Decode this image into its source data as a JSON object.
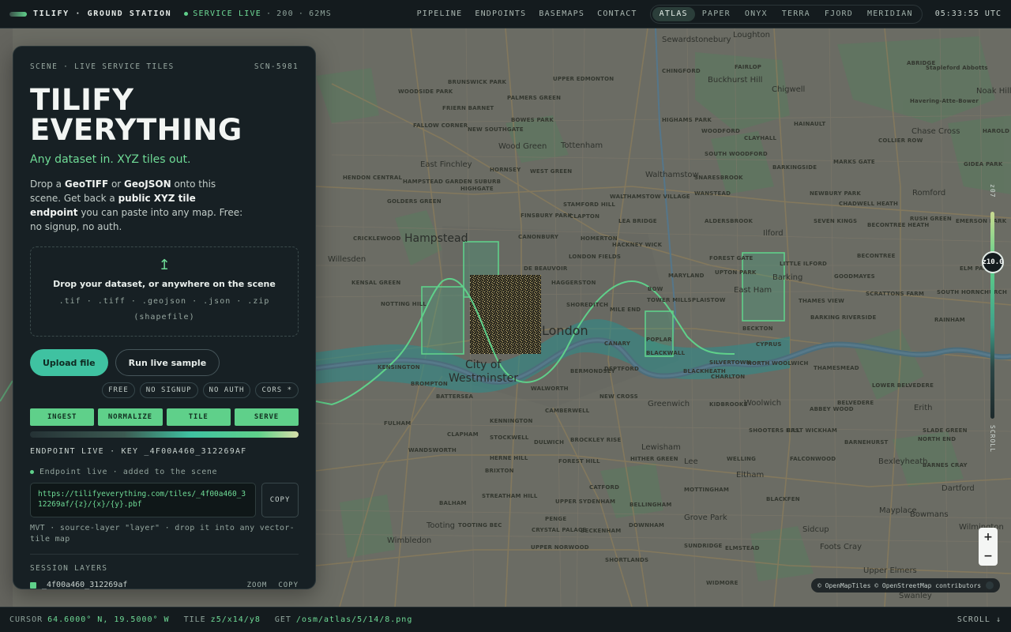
{
  "topbar": {
    "brand": "TILIFY · GROUND STATION",
    "status_label": "SERVICE LIVE",
    "status_code": "200",
    "status_latency": "62MS",
    "nav": [
      "PIPELINE",
      "ENDPOINTS",
      "BASEMAPS",
      "CONTACT"
    ],
    "styles": [
      "ATLAS",
      "PAPER",
      "ONYX",
      "TERRA",
      "FJORD",
      "MERIDIAN"
    ],
    "active_style": "ATLAS",
    "clock": "05:33:55 UTC"
  },
  "panel": {
    "eyebrow": "SCENE · LIVE SERVICE TILES",
    "scene_id": "SCN-5981",
    "headline_line1": "TILIFY",
    "headline_line2": "EVERYTHING",
    "tagline": "Any dataset in. XYZ tiles out.",
    "intro": {
      "t1": "Drop a ",
      "b1": "GeoTIFF",
      "t2": " or ",
      "b2": "GeoJSON",
      "t3": " onto this scene. Get back a ",
      "b3": "public XYZ tile endpoint",
      "t4": " you can paste into any map. Free: no signup, no auth."
    },
    "dropzone": {
      "title": "Drop your dataset, or anywhere on the scene",
      "extensions": ".tif · .tiff · .geojson · .json · .zip (shapefile)"
    },
    "upload_label": "Upload file",
    "sample_label": "Run live sample",
    "badges": [
      "FREE",
      "NO SIGNUP",
      "NO AUTH",
      "CORS *"
    ],
    "stages": [
      "INGEST",
      "NORMALIZE",
      "TILE",
      "SERVE"
    ],
    "endpoint_header": "ENDPOINT LIVE · KEY _4F00A460_312269AF",
    "endpoint_status": "Endpoint live · added to the scene",
    "endpoint_url": "https://tilifyeverything.com/tiles/_4f00a460_312269af/{z}/{x}/{y}.pbf",
    "copy_label": "COPY",
    "mvt_note": "MVT · source-layer \"layer\" · drop it into any vector-tile map",
    "session_header": "SESSION LAYERS",
    "layers": [
      {
        "name": "_4f00a460_312269af",
        "zoom_label": "ZOOM",
        "copy_label": "COPY",
        "color": "#5fd08a"
      }
    ]
  },
  "map": {
    "labels": {
      "hampstead": "Hampstead",
      "london": "London",
      "city_of": "City of",
      "westminster": "Westminster",
      "walthamstow": "Walthamstow",
      "tottenham": "Tottenham",
      "wood_green": "Wood Green",
      "east_finchley": "East Finchley",
      "willesden": "Willesden",
      "ilford": "Ilford",
      "romford": "Romford",
      "east_ham": "East Ham",
      "barking": "Barking",
      "woolwich": "Woolwich",
      "greenwich": "Greenwich",
      "lewisham": "Lewisham",
      "eltham": "Eltham",
      "bexleyheath": "Bexleyheath",
      "erith": "Erith",
      "dartford": "Dartford",
      "sidcup": "Sidcup",
      "wimbledon": "Wimbledon",
      "tooting": "Tooting",
      "lee": "Lee",
      "loughton": "Loughton",
      "chigwell": "Chigwell",
      "buckhurst_hill": "Buckhurst Hill",
      "foots_cray": "Foots Cray",
      "swanley": "Swanley",
      "upper_norwood": "UPPER NORWOOD",
      "clapham": "CLAPHAM",
      "brixton": "BRIXTON",
      "camberwell": "CAMBERWELL",
      "peckham": "PECKHAM",
      "fulham": "FULHAM",
      "kensington": "KENSINGTON",
      "islington": "ISLINGTON",
      "hackney": "HACKNEY",
      "stratford": "STRATFORD",
      "plaistow": "PLAISTOW",
      "poplar": "POPLAR",
      "mile_end": "MILE END",
      "bow": "BOW",
      "leyton": "LEYTON",
      "stoke_newington": "STOKE NEWINGTON",
      "highgate": "HIGHGATE",
      "hornsey": "HORNSEY",
      "kilburn": "KILBURN",
      "cricklewood": "CRICKLEWOOD",
      "golders_green": "GOLDERS GREEN",
      "hendon": "HENDON CENTRAL",
      "sydenham": "SYDENHAM",
      "catford": "CATFORD",
      "bromley": "BROMLEY",
      "mottingham": "MOTTINGHAM",
      "plumstead": "PLUMSTEAD",
      "thamesmead": "THAMESMEAD",
      "dagenham": "DAGENHAM",
      "hornchurch": "HORNCHURCH",
      "chadwell_heath": "CHADWELL HEATH",
      "seven_kings": "SEVEN KINGS",
      "gants_hill": "GANTS HILL",
      "woodford": "WOODFORD",
      "walthamstow_v": "WALTHAMSTOW VILLAGE",
      "chingford": "CHINGFORD",
      "hainault": "HAINAULT",
      "rainham": "RAINHAM",
      "sewardstonebury": "Sewardstonebury",
      "abridge": "ABRIDGE",
      "stapleford": "Stapleford Abbotts",
      "havering": "Havering-Atte-Bower",
      "noak_hill": "Noak Hill",
      "chase_cross": "Chase Cross",
      "harold_hill": "HAROLD HILL",
      "collier_row": "COLLIER ROW",
      "slade_green": "SLADE GREEN",
      "welling": "WELLING",
      "blackheath": "BLACKHEATH",
      "new_eltham": "NEW ELTHAM",
      "chislehurst": "CHISLEHURST",
      "orpington": "ORPINGTON",
      "petts_wood": "PETTS WOOD",
      "beckenham": "BECKENHAM",
      "penge": "PENGE",
      "crystal_palace": "CRYSTAL PALACE",
      "streatham": "STREATHAM",
      "dulwich": "DULWICH",
      "battersea": "BATTERSEA",
      "wandsworth": "WANDSWORTH",
      "putney": "PUTNEY",
      "hammersmith": "HAMMERSMITH",
      "acton": "ACTON",
      "ealing": "EALING",
      "shepherds_bush": "SHEPHERD'S BUSH",
      "walworth": "WALWORTH",
      "bermondsey": "BERMONDSEY",
      "deptford": "DEPTFORD",
      "new_cross": "NEW CROSS",
      "brockley": "BROCKLEY",
      "forest_hill": "FOREST HILL",
      "herne_hill": "HERNE HILL",
      "stockwell": "STOCKWELL",
      "vauxhall": "VAUXHALL",
      "kennington": "KENNINGTON",
      "hoxton": "HOXTON",
      "dalston": "DALSTON",
      "homerton": "HOMERTON",
      "hackney_wick": "HACKNEY WICK",
      "shoreditch": "SHOREDITCH",
      "haggerston": "HAGGERSTON",
      "bethnal_green": "BETHNAL GREEN",
      "whitechapel": "WHITECHAPEL",
      "canary": "CANARY",
      "wapping": "WAPPING",
      "silvertown": "SILVERTOWN",
      "canning_town": "CANNING TOWN",
      "north_woolwich": "NORTH WOOLWICH",
      "charlton": "CHARLTON",
      "kidbrooke": "KIDBROOKE",
      "lower_belvedere": "LOWER BELVEDERE",
      "abbey_wood": "ABBEY WOOD",
      "blackfen": "BLACKFEN",
      "upper_sydenham": "UPPER SYDENHAM",
      "streatham_hill": "STREATHAM HILL",
      "grove_park": "Grove Park",
      "upper_elmers": "Upper Elmers",
      "sundridge": "SUNDRIDGE",
      "shortlands": "SHORTLANDS",
      "widmore": "WIDMORE",
      "elmstead": "ELMSTEAD",
      "mitcham": "MITCHAM",
      "wimbledon_park": "WIMBLEDON PARK",
      "tooting_bec": "TOOTING BEC",
      "balham": "BALHAM",
      "muswell_hill": "MUSWELL HILL",
      "crouch_end": "CROUCH END",
      "finsbury_park": "FINSBURY PARK",
      "harringay": "HARRINGAY",
      "friern_barnet": "FRIERN BARNET",
      "new_southgate": "NEW SOUTHGATE",
      "palmers_green": "PALMERS GREEN",
      "bowes_park": "BOWES PARK",
      "edmonton": "EDMONTON",
      "upper_edmonton": "UPPER EDMONTON",
      "lower_edmonton": "LOWER EDMONTON",
      "whetstone": "WHETSTONE",
      "brunswick_park": "BRUNSWICK PARK",
      "east_barnet": "EAST BARNET",
      "woodside_park": "WOODSIDE PARK",
      "fallow_corner": "FALLOW CORNER",
      "mill_hill": "MILL HILL",
      "west_hendon": "WEST HENDON",
      "neasden": "NEASDEN",
      "dollis_hill": "DOLLIS HILL",
      "hampstead_garden": "HAMPSTEAD GARDEN SUBURB",
      "temple_fortune": "TEMPLE FORTUNE",
      "west_green": "WEST GREEN",
      "bruce_grove": "BRUCE GROVE",
      "stamford_hill": "STAMFORD HILL",
      "clapton": "CLAPTON",
      "lea_bridge": "LEA BRIDGE",
      "forest_gate": "FOREST GATE",
      "manor_park": "MANOR PARK",
      "upton_park": "UPTON PARK",
      "beckton": "BECKTON",
      "little_ilford": "LITTLE ILFORD",
      "goodmayes": "GOODMAYES",
      "becontree": "BECONTREE",
      "becontree_heath": "BECONTREE HEATH",
      "scrattons": "SCRATTONS FARM",
      "thames_view": "THAMES VIEW",
      "barking_riverside": "BARKING RIVERSIDE",
      "south_hornchurch": "SOUTH HORNCHURCH",
      "elm_park": "ELM PARK",
      "harold_wood": "HAROLD WOOD",
      "emerson_park": "EMERSON PARK",
      "gidea_park": "GIDEA PARK",
      "rush_green": "RUSH GREEN",
      "clayhall": "CLAYHALL",
      "barkingside": "BARKINGSIDE",
      "newbury_park": "NEWBURY PARK",
      "south_woodford": "SOUTH WOODFORD",
      "snaresbrook": "SNARESBROOK",
      "wanstead": "WANSTEAD",
      "aldersbrook": "ALDERSBROOK",
      "highams_park": "HIGHAMS PARK",
      "fairlop": "FAIRLOP",
      "woodford_green": "WOODFORD GREEN",
      "marks_gate": "MARKS GATE",
      "maryland": "MARYLAND",
      "west_ham": "WEST HAM",
      "cyprus": "CYPRUS",
      "belvedere": "BELVEDERE",
      "falconwood": "FALCONWOOD",
      "shooters_hill": "SHOOTERS HILL",
      "east_wickham": "EAST WICKHAM",
      "barnehurst": "BARNEHURST",
      "crayford": "CRAYFORD",
      "bexley": "BEXLEY",
      "north_end": "NORTH END",
      "barnes_cray": "BARNES CRAY",
      "wilmington": "Wilmington",
      "mayplace": "Mayplace",
      "bowmans": "Bowmans",
      "the_oval": "THE OVAL",
      "nunhead": "NUNHEAD",
      "honor_oak": "HONOR OAK",
      "hither_green": "HITHER GREEN",
      "lee_green": "LEE GREEN",
      "brockley_rise": "BROCKLEY RISE",
      "bellingham": "BELLINGHAM",
      "downham": "DOWNHAM",
      "southend": "SOUTHEND",
      "ladywell": "LADYWELL",
      "blackwall": "BLACKWALL",
      "isle_of_dogs": "ISLE OF DOGS",
      "tower_mills": "TOWER MILLS",
      "rotherhithe": "ROTHERHITHE",
      "battersea_park": "BATTERSEA PARK",
      "earls_court": "EARL'S COURT",
      "chelsea": "CHELSEA",
      "brompton": "BROMPTON",
      "notting_hill": "NOTTING HILL",
      "maida_vale": "MAIDA VALE",
      "kensal_green": "KENSAL GREEN",
      "harlesden": "HARLESDEN",
      "stonebridge": "STONEBRIDGE",
      "old_oak": "OLD OAK COMMON",
      "west_hampstead": "WEST HAMPSTEAD",
      "belsize_park": "BELSIZE PARK",
      "primrose_hill": "PRIMROSE HILL",
      "kentish_town": "KENTISH TOWN",
      "camden": "CAMDEN",
      "holloway": "HOLLOWAY",
      "barnsbury": "BARNSBURY",
      "canonbury": "CANONBURY",
      "de_beauvoir": "DE BEAUVOIR",
      "london_fields": "LONDON FIELDS",
      "south_hackney": "SOUTH HACKNEY",
      "victoria_park": "VICTORIA PARK",
      "old_ford": "OLD FORD",
      "bromley_by_bow": "BROMLEY BY BOW",
      "limehouse": "LIMEHOUSE",
      "stepney": "STEPNEY"
    },
    "road_shields": [
      "A406",
      "A10",
      "A1",
      "A503",
      "A5",
      "A4",
      "A3",
      "A23",
      "A2",
      "A20",
      "A13",
      "A12",
      "A11",
      "A127",
      "A118",
      "A124",
      "A205",
      "A21",
      "A222",
      "A214",
      "A24",
      "A217",
      "A306",
      "A3212",
      "A205",
      "A3205",
      "A2213",
      "A2016"
    ],
    "zoom_display": "z10.0",
    "zoom_top_label": "z07",
    "zoom_bottom_label": "SCROLL",
    "zoom_in": "+",
    "zoom_out": "−",
    "attribution": "© OpenMapTiles © OpenStreetMap contributors"
  },
  "bottombar": {
    "cursor_label": "CURSOR",
    "cursor_value": "64.6000° N, 19.5000° W",
    "tile_label": "TILE",
    "tile_value": "z5/x14/y8",
    "get_label": "GET",
    "get_value": "/osm/atlas/5/14/8.png",
    "scroll_label": "SCROLL ↓"
  },
  "colors": {
    "accent_green": "#5fd08a",
    "accent_teal": "#3fc2a1",
    "panel_bg": "#172024",
    "topbar_bg": "#141b1e",
    "map_base": "#6b6c64"
  }
}
